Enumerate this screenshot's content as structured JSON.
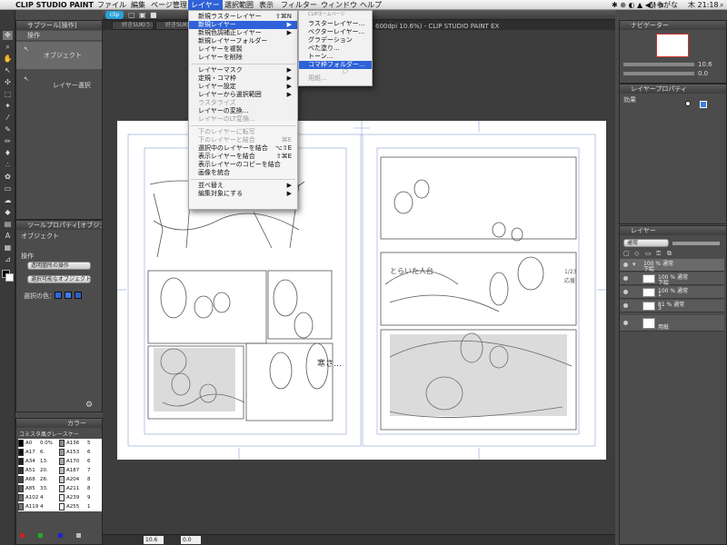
{
  "menubar": {
    "app": "CLIP STUDIO PAINT",
    "items": [
      "ファイル",
      "編集",
      "ページ管理",
      "レイヤー",
      "選択範囲",
      "表示",
      "フィルター",
      "ウィンドウ",
      "ヘルプ"
    ],
    "right_user": "ひらがな",
    "clock": "木 21:18"
  },
  "left_top": {
    "title": "サブツール[操作]",
    "group": "操作",
    "items": [
      "オブジェクト",
      "レイヤー選択"
    ]
  },
  "tool_property": {
    "title": "ツールプロパティ[オブジェクト]",
    "subtitle": "オブジェクト",
    "section": "操作",
    "mode_button": "透明箇所の操作",
    "select_button": "選択可能なオブジェクト",
    "select_label": "選択の色："
  },
  "color_panel": {
    "title": "カラー",
    "palette_title": "コミスタ風グレースケー",
    "rows": [
      [
        "A0",
        "0.0%",
        "A136",
        "5"
      ],
      [
        "A17",
        "6.",
        "A153",
        "6"
      ],
      [
        "A34",
        "13.",
        "A170",
        "6"
      ],
      [
        "A51",
        "20.",
        "A187",
        "7"
      ],
      [
        "A68",
        "26.",
        "A204",
        "8"
      ],
      [
        "A85",
        "33.",
        "A211",
        "8"
      ],
      [
        "A102",
        "4",
        "A239",
        "9"
      ],
      [
        "A119",
        "4",
        "A255",
        "1"
      ]
    ]
  },
  "document": {
    "title_fragment": "600dpi 10.6%) - CLIP STUDIO PAINT EX",
    "tabs": [
      "好きSUKIうさ",
      "好きSUKIうさ"
    ],
    "footer_zoom": "10.6",
    "footer_value": "0.0"
  },
  "layer_menu": {
    "items": [
      {
        "label": "新規ラスターレイヤー",
        "shortcut": "⇧⌘N"
      },
      {
        "label": "新規レイヤー",
        "arrow": "▶",
        "highlight": true
      },
      {
        "label": "新規色調補正レイヤー",
        "arrow": "▶"
      },
      {
        "label": "新規レイヤーフォルダー"
      },
      {
        "label": "レイヤーを複製"
      },
      {
        "label": "レイヤーを削除"
      },
      {
        "sep": true
      },
      {
        "label": "レイヤーマスク",
        "arrow": "▶"
      },
      {
        "label": "定規・コマ枠",
        "arrow": "▶"
      },
      {
        "label": "レイヤー設定",
        "arrow": "▶"
      },
      {
        "label": "レイヤーから選択範囲",
        "arrow": "▶"
      },
      {
        "label": "ラスタライズ",
        "disabled": true
      },
      {
        "label": "レイヤーの変換..."
      },
      {
        "label": "レイヤーのLT変換...",
        "disabled": true
      },
      {
        "sep": true
      },
      {
        "label": "下のレイヤーに転写",
        "disabled": true
      },
      {
        "label": "下のレイヤーと結合",
        "shortcut": "⌘E",
        "disabled": true
      },
      {
        "label": "選択中のレイヤーを結合",
        "shortcut": "⌥⇧E"
      },
      {
        "label": "表示レイヤーを結合",
        "shortcut": "⇧⌘E"
      },
      {
        "label": "表示レイヤーのコピーを結合"
      },
      {
        "label": "画像を統合"
      },
      {
        "sep": true
      },
      {
        "label": "並べ替え",
        "arrow": "▶"
      },
      {
        "label": "編集対象にする",
        "arrow": "▶"
      }
    ]
  },
  "submenu": {
    "header": "CLIPホームページ",
    "items": [
      {
        "label": "ラスターレイヤー..."
      },
      {
        "label": "ベクターレイヤー..."
      },
      {
        "label": "グラデーション"
      },
      {
        "label": "べた塗り..."
      },
      {
        "label": "トーン..."
      },
      {
        "label": "コマ枠フォルダー...",
        "highlight": true
      },
      {
        "label": "用紙...",
        "disabled": true
      }
    ]
  },
  "navigator": {
    "title": "ナビゲーター",
    "zoom": "10.6",
    "angle": "0.0"
  },
  "layer_property": {
    "title": "レイヤープロパティ",
    "effect_label": "効果"
  },
  "layers_panel": {
    "title": "レイヤー",
    "blend_mode": "通常",
    "layers": [
      {
        "opacity": "100 %",
        "mode": "通常",
        "name": "下絵",
        "folder": true
      },
      {
        "opacity": "100 %",
        "mode": "通常",
        "name": "下絵"
      },
      {
        "opacity": "100 %",
        "mode": "通常",
        "name": "1"
      },
      {
        "opacity": "81 %",
        "mode": "通常",
        "name": "3"
      },
      {
        "opacity": "",
        "mode": "",
        "name": "用紙"
      }
    ]
  },
  "pages": {
    "right_note_1": "とらいた人台",
    "right_note_2": "寒さ…",
    "right_margin_note_1": "1/23",
    "right_margin_note_2": "応援"
  },
  "colors": {
    "menu_highlight": "#2f62d8",
    "ui_dark": "#3d3d3d"
  }
}
